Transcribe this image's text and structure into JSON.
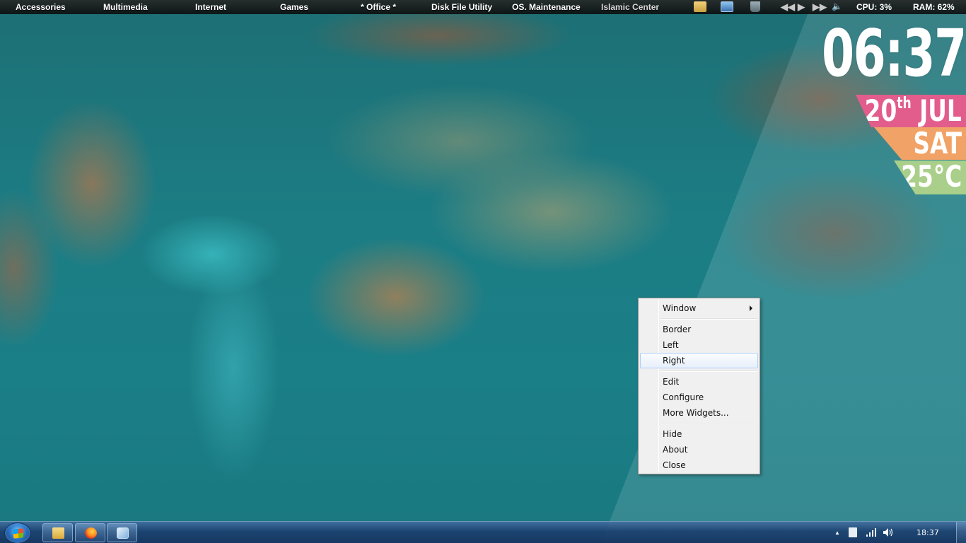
{
  "top_menu": {
    "items": [
      "Accessories",
      "Multimedia",
      "Internet",
      "Games",
      "* Office *",
      "Disk File Utility",
      "OS. Maintenance",
      "Islamic Center"
    ],
    "icons": [
      "picture-folder-icon",
      "monitor-icon",
      "recycle-bin-icon"
    ],
    "media": {
      "prev": "◀◀",
      "play": "▶",
      "next": "▶▶",
      "volume": "🔈"
    },
    "cpu": "CPU: 3%",
    "ram": "RAM: 62%"
  },
  "clock_widget": {
    "time": "06:37",
    "date_day": "20",
    "date_suffix": "th",
    "date_month": "JUL",
    "weekday": "SAT",
    "temperature": "25°C",
    "colors": {
      "date": "#e25d8c",
      "weekday": "#f1a266",
      "temperature": "#a9cf8a"
    }
  },
  "context_menu": {
    "items": [
      "Window",
      "Border",
      "Left",
      "Right",
      "Edit",
      "Configure",
      "More Widgets...",
      "Hide",
      "About",
      "Close"
    ],
    "highlighted": "Right"
  },
  "taskbar": {
    "pinned": [
      "file-explorer-icon",
      "firefox-icon",
      "control-panel-icon"
    ],
    "tray": {
      "show_hidden": "▲",
      "clock": "18:37"
    }
  }
}
